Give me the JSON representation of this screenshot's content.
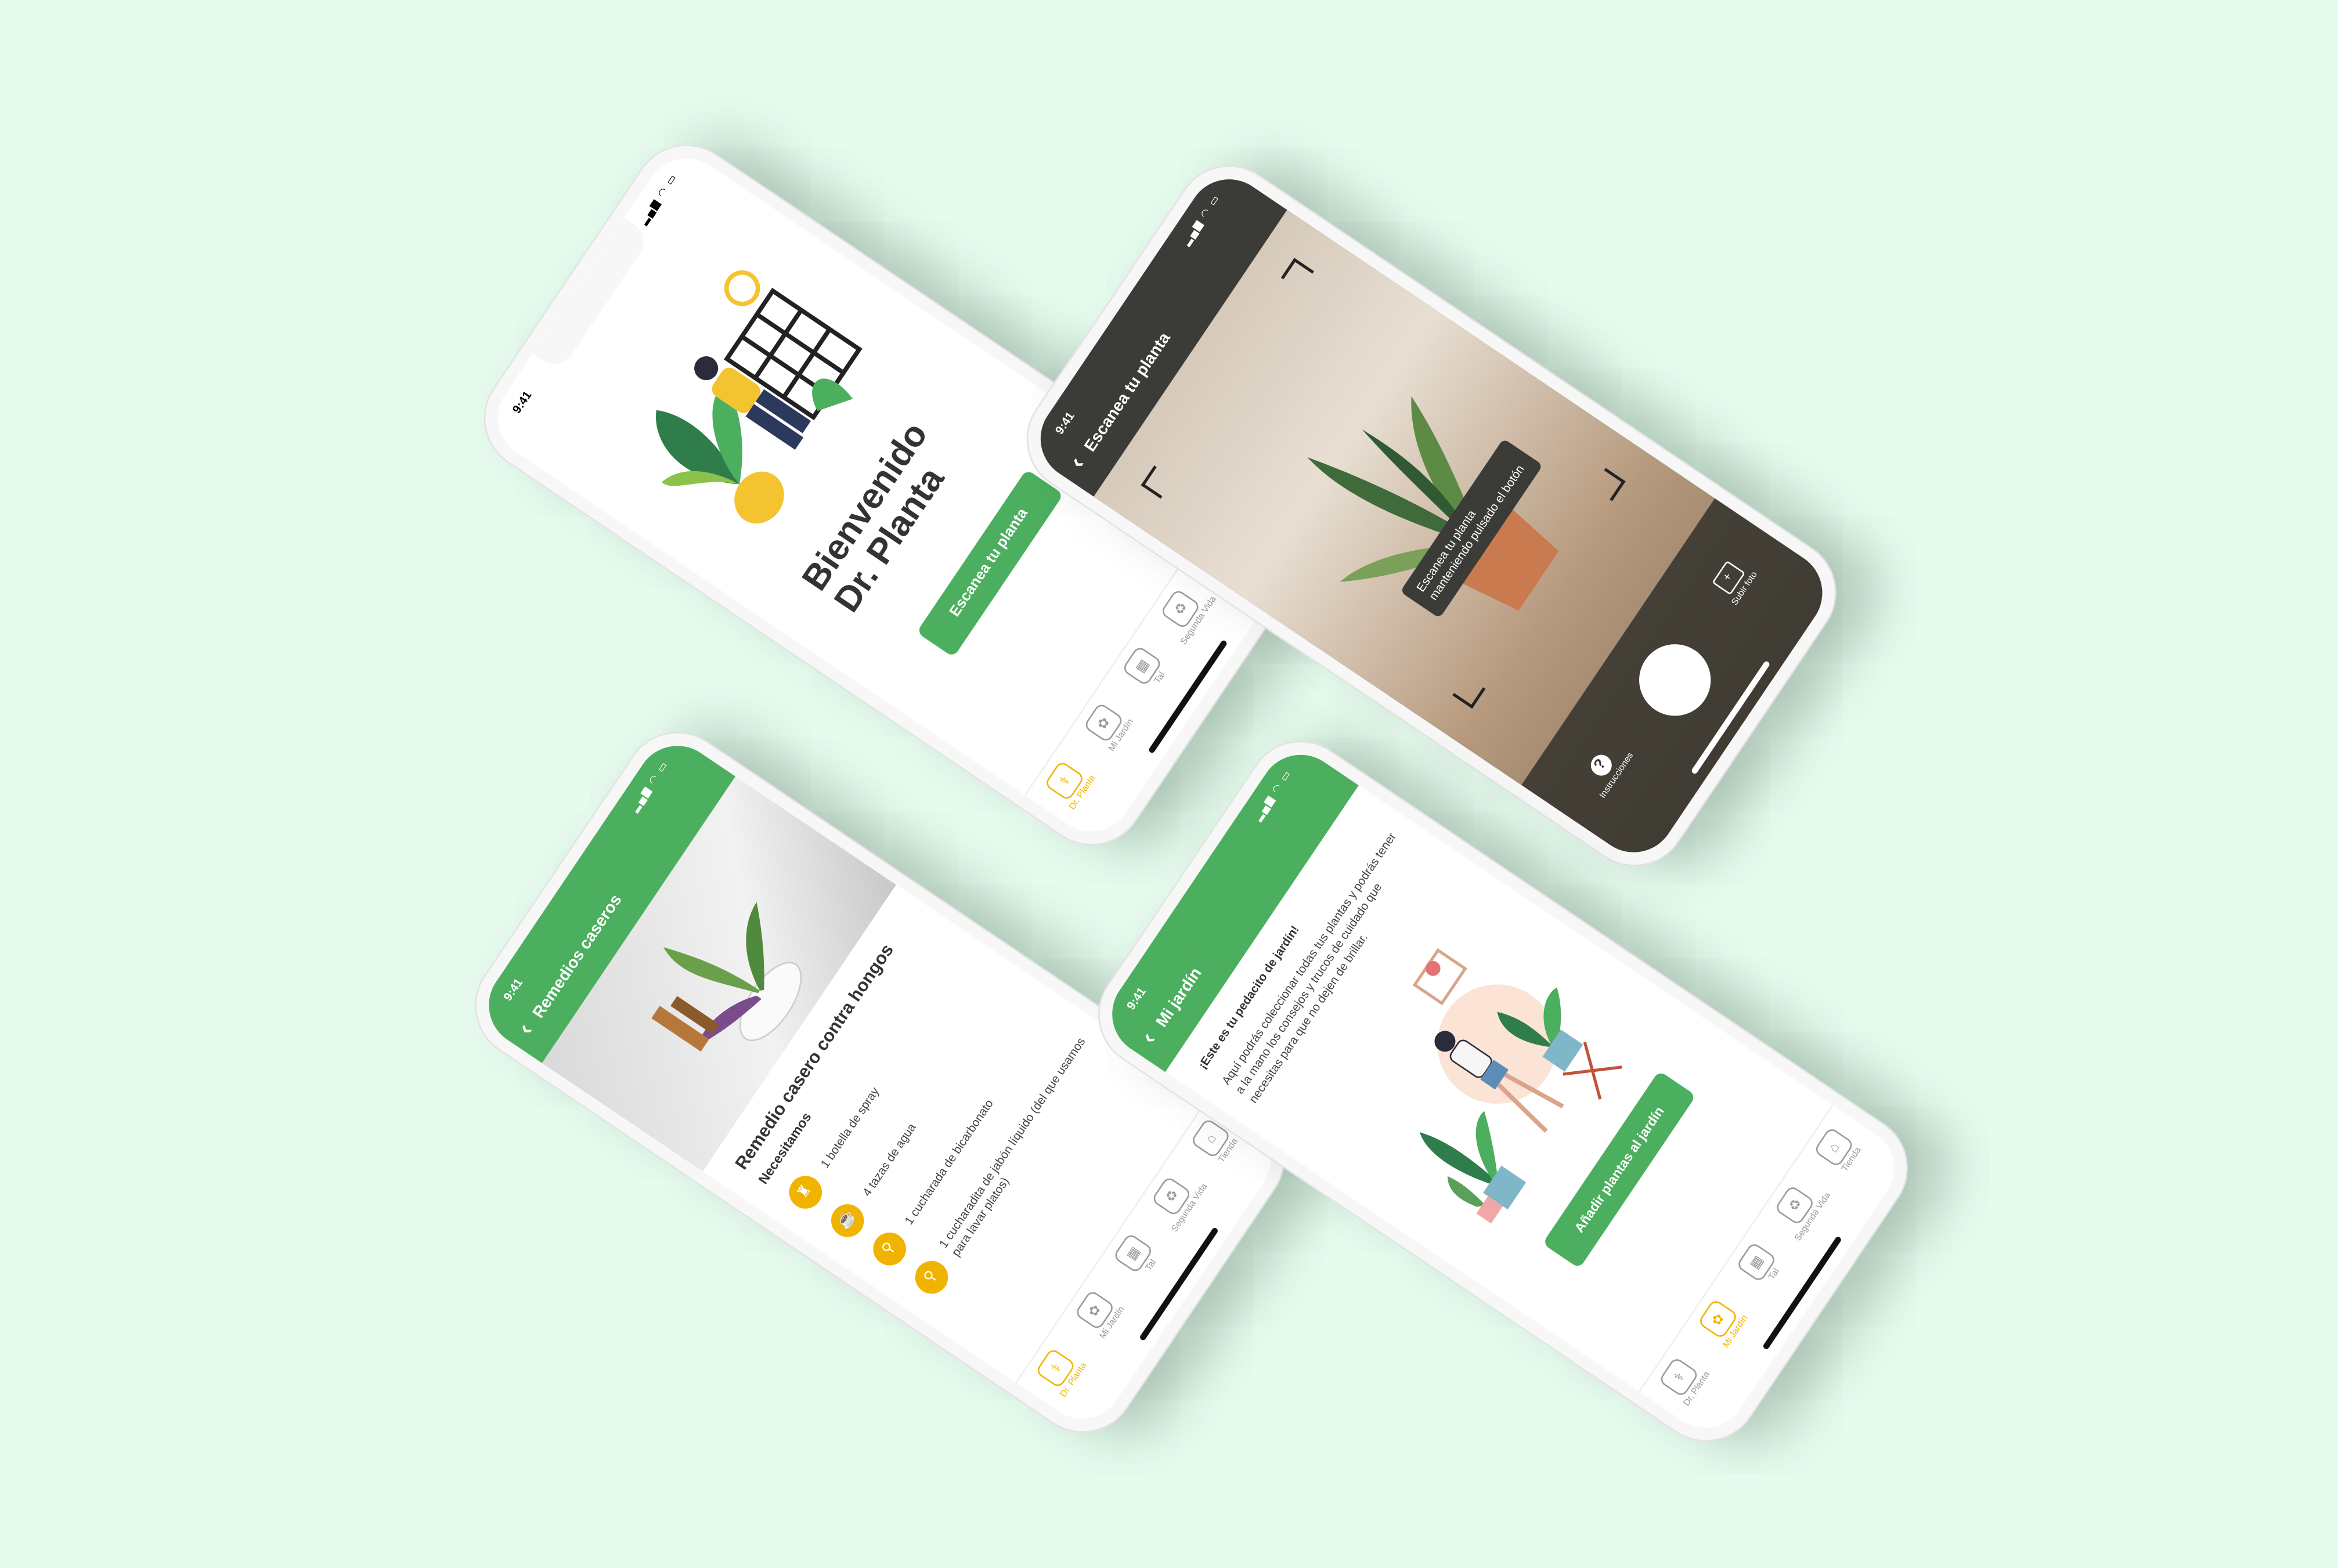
{
  "status_time": "9:41",
  "tabs": [
    "Dr. Planta",
    "Mi Jardín",
    "Tal",
    "Segunda Vida",
    "Tienda"
  ],
  "welcome": {
    "title_line1": "Bienvenido",
    "title_line2": "Dr. Planta",
    "button": "Escanea tu planta"
  },
  "scan": {
    "title": "Escanea tu planta",
    "tooltip": "Escanea tu planta manteniendo pulsado el botón",
    "instructions": "Instrucciones",
    "upload": "Subir foto"
  },
  "remedies": {
    "title": "Remedios caseros",
    "heading": "Remedio casero contra hongos",
    "needs": "Necesitamos",
    "items": [
      "1 botella de spray",
      "4 tazas de agua",
      "1 cucharada de bicarbonato",
      "1 cucharadita de jabón líquido (del que usamos para lavar platos)"
    ]
  },
  "garden": {
    "title": "Mi jardín",
    "heading": "¡Este es tu pedacito de jardín!",
    "body": "Aquí podrás coleccionar todas tus plantas y podrás tener a la mano los consejos y trucos de cuidado que necesitas para que no dejen de brillar.",
    "button": "Añadir plantas al jardín"
  },
  "colors": {
    "background": "#e6fbee",
    "green": "#4caf5f",
    "accent": "#f0b400"
  }
}
